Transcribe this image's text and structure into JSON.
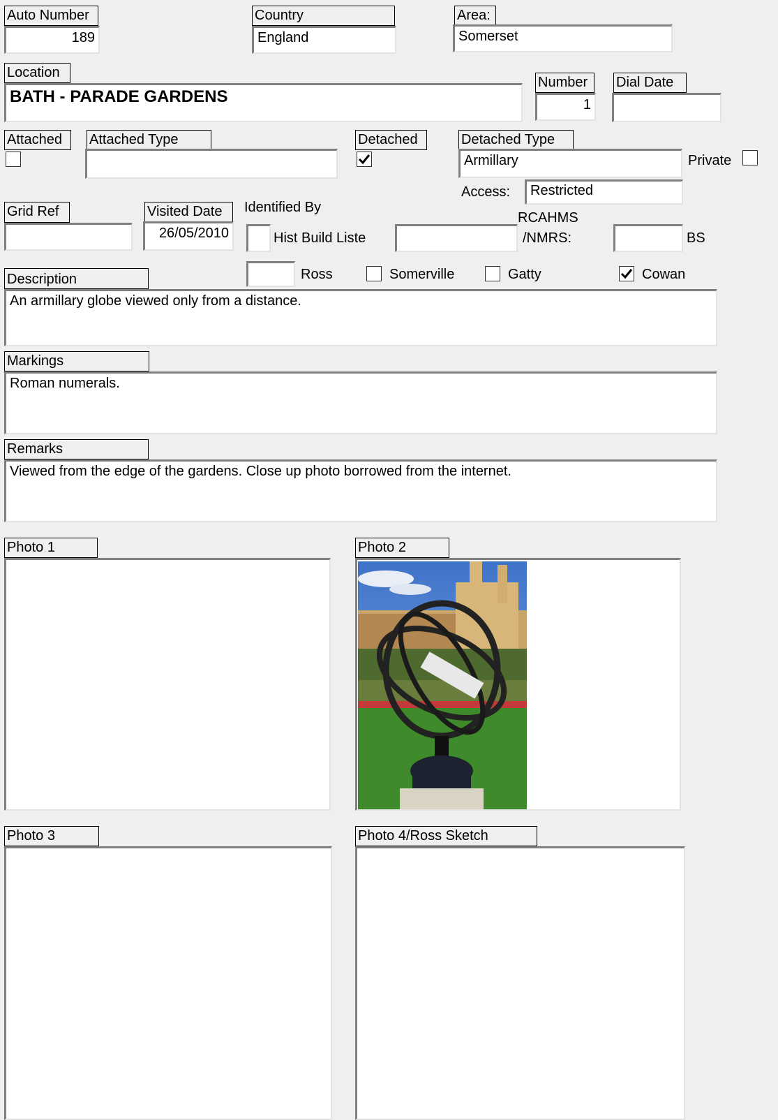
{
  "labels": {
    "auto_number": "Auto Number",
    "country": "Country",
    "area": "Area:",
    "location": "Location",
    "number": "Number",
    "dial_date": "Dial Date",
    "attached": "Attached",
    "attached_type": "Attached Type",
    "detached": "Detached",
    "detached_type": "Detached Type",
    "private": "Private",
    "access": "Access:",
    "grid_ref": "Grid Ref",
    "visited_date": "Visited Date",
    "identified_by": "Identified By",
    "hist_build_liste": "Hist Build Liste",
    "rcahms_line1": "RCAHMS",
    "rcahms_line2": "/NMRS:",
    "bs": "BS",
    "ross": "Ross",
    "somerville": "Somerville",
    "gatty": "Gatty",
    "cowan": "Cowan",
    "description": "Description",
    "markings": "Markings",
    "remarks": "Remarks",
    "photo1": "Photo 1",
    "photo2": "Photo 2",
    "photo3": "Photo 3",
    "photo4": "Photo 4/Ross Sketch"
  },
  "values": {
    "auto_number": "189",
    "country": "England",
    "area": "Somerset",
    "location": "BATH - PARADE GARDENS",
    "number": "1",
    "dial_date": "",
    "attached_type": "",
    "detached_type": "Armillary",
    "access": "Restricted",
    "grid_ref": "",
    "visited_date": "26/05/2010",
    "rcahms": "",
    "bs": "",
    "ross": "",
    "description": "An armillary globe viewed only from a distance.",
    "markings": "Roman numerals.",
    "remarks": "Viewed from the edge of the gardens.  Close up photo borrowed from the internet."
  },
  "checkboxes": {
    "attached": false,
    "detached": true,
    "private": false,
    "hist_build_liste": false,
    "somerville": false,
    "gatty": false,
    "cowan": true
  }
}
